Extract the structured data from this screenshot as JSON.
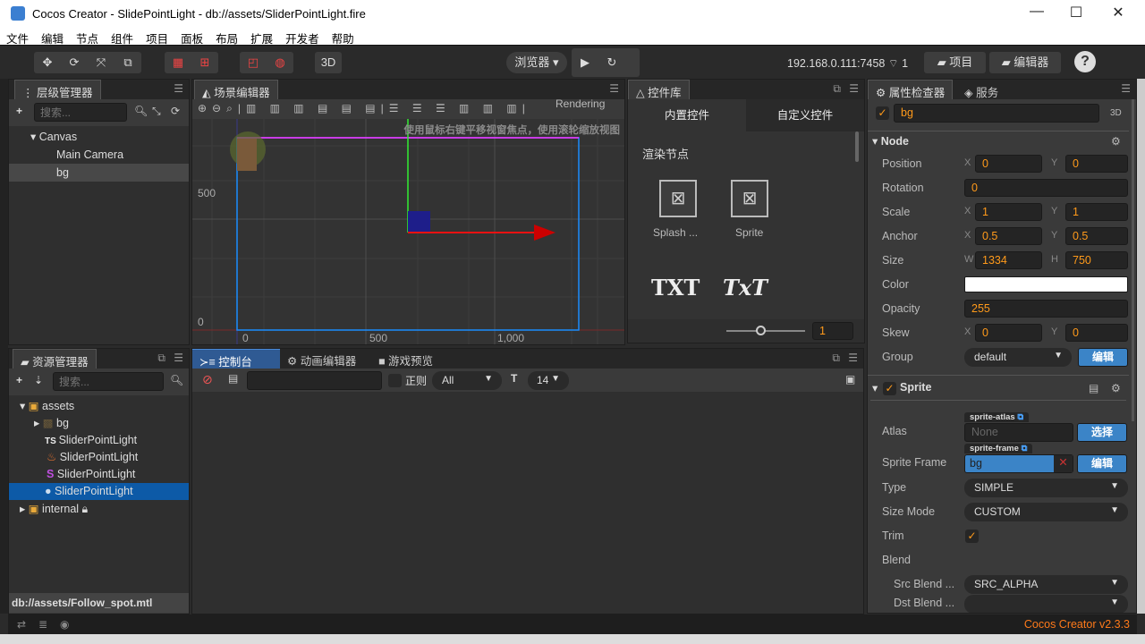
{
  "window": {
    "title": "Cocos Creator - SlidePointLight - db://assets/SliderPointLight.fire",
    "minimize": "—",
    "maximize": "☐",
    "close": "✕"
  },
  "menu": [
    "文件",
    "编辑",
    "节点",
    "组件",
    "项目",
    "面板",
    "布局",
    "扩展",
    "开发者",
    "帮助"
  ],
  "toolbar": {
    "mode_3d": "3D",
    "browser": "浏览器 ▾",
    "play": "▶",
    "refresh": "↻",
    "ip": "192.168.0.111:7458",
    "devices": "1",
    "project": "项目",
    "editor": "编辑器",
    "help": "?"
  },
  "hierarchy": {
    "title": "层级管理器",
    "search_placeholder": "搜索...",
    "nodes": [
      {
        "label": "Canvas",
        "depth": 0,
        "expanded": true
      },
      {
        "label": "Main Camera",
        "depth": 1
      },
      {
        "label": "bg",
        "depth": 1,
        "selected": true
      }
    ]
  },
  "scene": {
    "title": "场景编辑器",
    "render_mode": "Rendering",
    "hint": "使用鼠标右键平移视窗焦点，使用滚轮缩放视图",
    "y_ticks": [
      "500",
      "0"
    ],
    "x_ticks": [
      "0",
      "500",
      "1,000"
    ]
  },
  "widgets": {
    "title": "控件库",
    "tabs": [
      "内置控件",
      "自定义控件"
    ],
    "section": "渲染节点",
    "items": [
      "Splash ...",
      "Sprite"
    ],
    "text_items": [
      "TXT",
      "TxT"
    ],
    "zoom_value": "1"
  },
  "inspector": {
    "title": "属性检查器",
    "service_tab": "服务",
    "node_name": "bg",
    "mode": "3D",
    "node_section": "Node",
    "position": {
      "x": "0",
      "y": "0"
    },
    "rotation": "0",
    "scale": {
      "x": "1",
      "y": "1"
    },
    "anchor": {
      "x": "0.5",
      "y": "0.5"
    },
    "size": {
      "w": "1334",
      "h": "750"
    },
    "opacity": "255",
    "skew": {
      "x": "0",
      "y": "0"
    },
    "group": "default",
    "group_edit": "编辑",
    "labels": {
      "position": "Position",
      "rotation": "Rotation",
      "scale": "Scale",
      "anchor": "Anchor",
      "size": "Size",
      "color": "Color",
      "opacity": "Opacity",
      "skew": "Skew",
      "group": "Group"
    },
    "sprite": {
      "section": "Sprite",
      "atlas_label": "Atlas",
      "atlas_tag": "sprite-atlas",
      "atlas_value": "None",
      "atlas_button": "选择",
      "frame_label": "Sprite Frame",
      "frame_tag": "sprite-frame",
      "frame_value": "bg",
      "frame_button": "编辑",
      "type_label": "Type",
      "type": "SIMPLE",
      "size_mode_label": "Size Mode",
      "size_mode": "CUSTOM",
      "trim_label": "Trim",
      "blend_label": "Blend",
      "src_blend_label": "Src Blend ...",
      "src_blend": "SRC_ALPHA",
      "dst_blend_label": "Dst Blend ..."
    },
    "axis_x": "X",
    "axis_y": "Y",
    "axis_w": "W",
    "axis_h": "H"
  },
  "assets": {
    "title": "资源管理器",
    "search_placeholder": "搜索...",
    "items": [
      {
        "label": "assets",
        "type": "folder"
      },
      {
        "label": "bg",
        "type": "texture"
      },
      {
        "label": "SliderPointLight",
        "type": "typescript"
      },
      {
        "label": "SliderPointLight",
        "type": "effect"
      },
      {
        "label": "SliderPointLight",
        "type": "shader"
      },
      {
        "label": "SliderPointLight",
        "type": "material",
        "selected": true
      },
      {
        "label": "internal",
        "type": "folder-locked"
      }
    ],
    "path": "db://assets/Follow_spot.mtl"
  },
  "console": {
    "tabs": [
      "控制台",
      "动画编辑器",
      "游戏预览"
    ],
    "regex_label": "正则",
    "level": "All",
    "font_size": "14"
  },
  "status": {
    "version": "Cocos Creator v2.3.3"
  },
  "colors": {
    "accent": "#ff9a1a",
    "selection": "#0d5aa7",
    "button_blue": "#3b84c7"
  }
}
